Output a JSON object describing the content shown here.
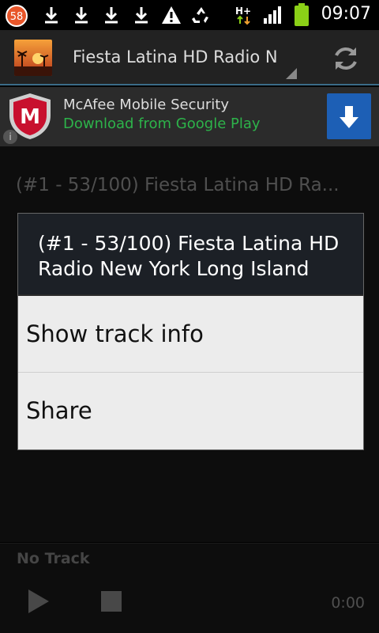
{
  "status_bar": {
    "notification_count": "58",
    "network_label": "H+",
    "time": "09:07",
    "icons": [
      "notification-badge-icon",
      "download-icon",
      "download-icon",
      "download-icon",
      "download-icon",
      "warning-icon",
      "recycle-icon",
      "network-hplus-icon",
      "signal-icon",
      "battery-icon"
    ]
  },
  "action_bar": {
    "title": "Fiesta Latina HD Radio N",
    "refresh_icon": "refresh-icon"
  },
  "ad": {
    "title": "McAfee Mobile Security",
    "subtitle": "Download from Google Play",
    "info": "i",
    "download_icon": "download-arrow-icon"
  },
  "main": {
    "track_title": "(#1 - 53/100) Fiesta Latina HD Ra..."
  },
  "dialog": {
    "title": "(#1 - 53/100) Fiesta Latina HD Radio New York Long Island",
    "items": [
      "Show track info",
      "Share"
    ]
  },
  "player": {
    "status": "No Track",
    "time": "0:00"
  },
  "colors": {
    "accent_line": "#3b6b87",
    "ad_green": "#2db34a",
    "ad_button": "#1d5fb5",
    "battery": "#8bd017"
  }
}
